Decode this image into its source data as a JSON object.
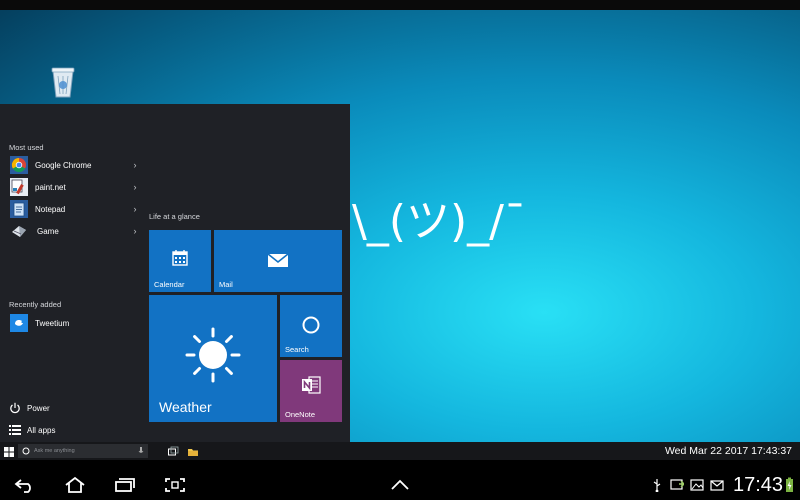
{
  "start_menu": {
    "most_used_label": "Most used",
    "most_used": [
      {
        "label": "Google Chrome",
        "icon": "chrome-icon"
      },
      {
        "label": "paint.net",
        "icon": "paintnet-icon"
      },
      {
        "label": "Notepad",
        "icon": "notepad-icon"
      },
      {
        "label": "Game",
        "icon": "game-icon"
      }
    ],
    "recently_added_label": "Recently added",
    "recently_added": [
      {
        "label": "Tweetium",
        "icon": "tweetium-icon"
      }
    ],
    "power_label": "Power",
    "all_apps_label": "All apps",
    "tiles_header": "Life at a glance",
    "tiles": {
      "calendar": "Calendar",
      "mail": "Mail",
      "weather": "Weather",
      "search": "Search",
      "onenote": "OneNote"
    }
  },
  "desktop": {
    "shrug_text": "\\_(ツ)_/¯"
  },
  "taskbar": {
    "search_placeholder": "Ask me anything",
    "clock": "Wed Mar 22 2017 17:43:37"
  },
  "android": {
    "time": "17:43"
  },
  "colors": {
    "tile_blue": "#1272c4",
    "onenote_purple": "#80397b",
    "menu_bg": "#1f2126"
  }
}
